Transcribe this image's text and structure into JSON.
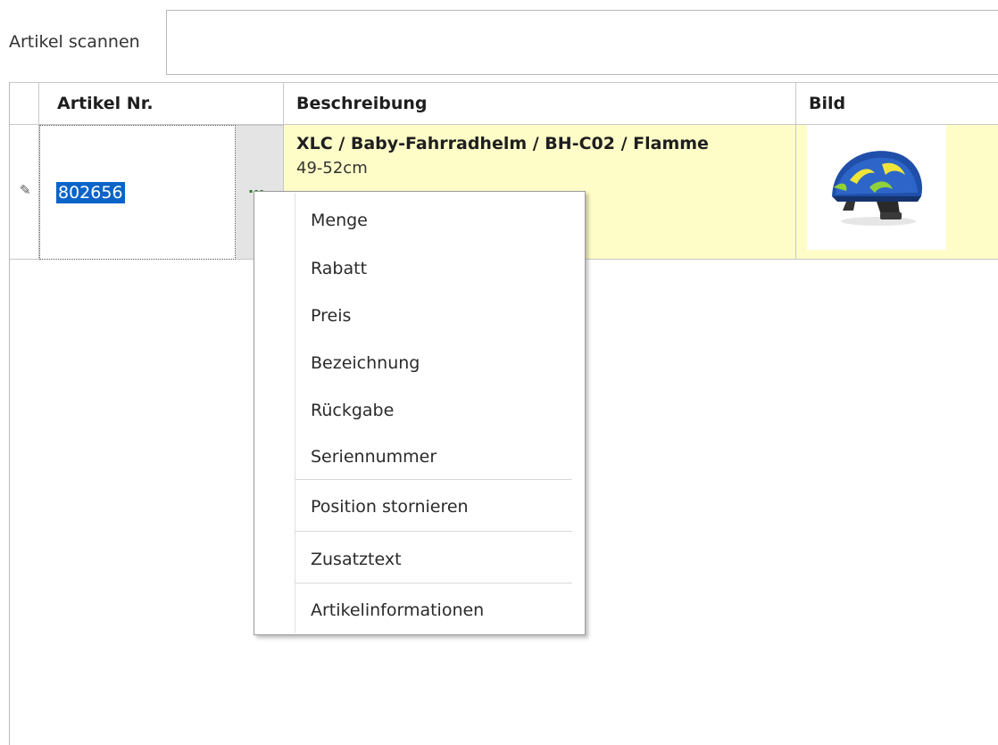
{
  "scan": {
    "label": "Artikel scannen",
    "value": ""
  },
  "grid": {
    "columns": {
      "artnr": "Artikel Nr.",
      "description": "Beschreibung",
      "image": "Bild"
    },
    "rows": [
      {
        "artnr": "802656",
        "ellipsis": "...",
        "title": "XLC / Baby-Fahrradhelm / BH-C02 / Flamme",
        "subtitle": "49-52cm",
        "image_icon": "bicycle-helmet-image"
      }
    ]
  },
  "context_menu": {
    "items": [
      "Menge",
      "Rabatt",
      "Preis",
      "Bezeichnung",
      "Rückgabe",
      "Seriennummer",
      "Position stornieren",
      "Zusatztext",
      "Artikelinformationen"
    ]
  },
  "colors": {
    "row_highlight": "#fefdc8",
    "selection": "#0a64c8",
    "ellipsis_cell": "#e4e4e4"
  }
}
